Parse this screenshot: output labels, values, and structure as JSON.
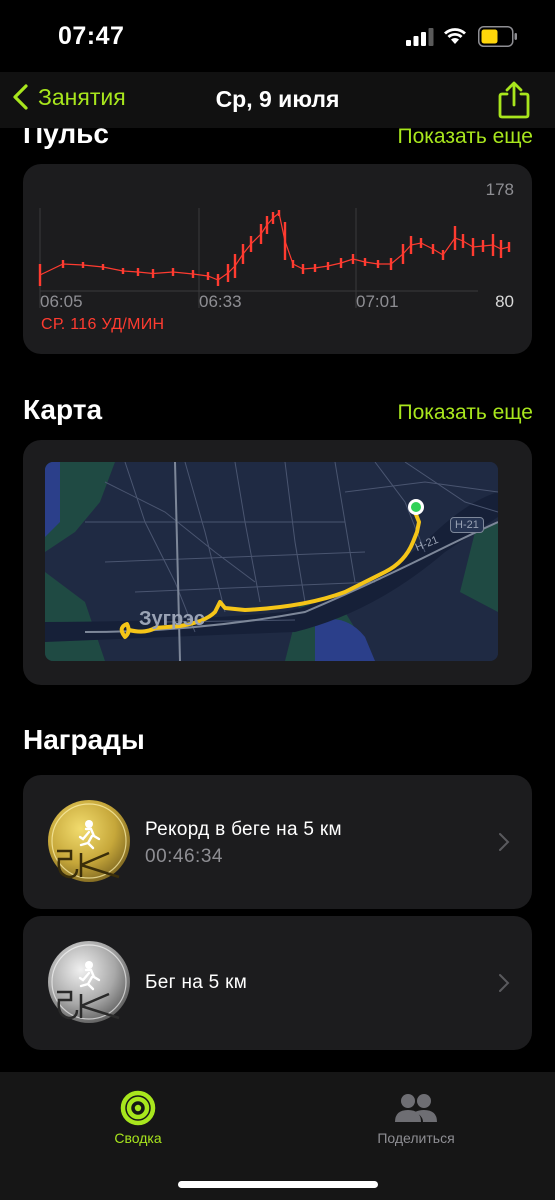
{
  "status": {
    "time": "07:47"
  },
  "nav": {
    "back_label": "Занятия",
    "title": "Ср, 9 июля"
  },
  "heart_rate": {
    "section_title": "Пульс",
    "show_more": "Показать еще",
    "max_label": "178",
    "min_label": "80",
    "time_ticks": [
      "06:05",
      "06:33",
      "07:01"
    ],
    "average_label": "СР. 116 УД/МИН",
    "line_color": "#ff3b30"
  },
  "map": {
    "section_title": "Карта",
    "show_more": "Показать еще",
    "town_label": "Зугрэс",
    "road_label": "Н-21",
    "road_badge": "Н-21",
    "route_color": "#f5c518"
  },
  "awards": {
    "section_title": "Награды",
    "items": [
      {
        "title": "Рекорд в беге на 5 км",
        "subtitle": "00:46:34",
        "medal": "gold-5k-medal-icon"
      },
      {
        "title": "Бег на 5 км",
        "subtitle": "",
        "medal": "silver-5k-medal-icon"
      }
    ]
  },
  "tabs": [
    {
      "label": "Сводка",
      "icon": "activity-rings-icon",
      "active": true
    },
    {
      "label": "Поделиться",
      "icon": "people-icon",
      "active": false
    }
  ],
  "colors": {
    "accent": "#a8e61d",
    "background": "#000000",
    "card": "#1c1c1e"
  }
}
